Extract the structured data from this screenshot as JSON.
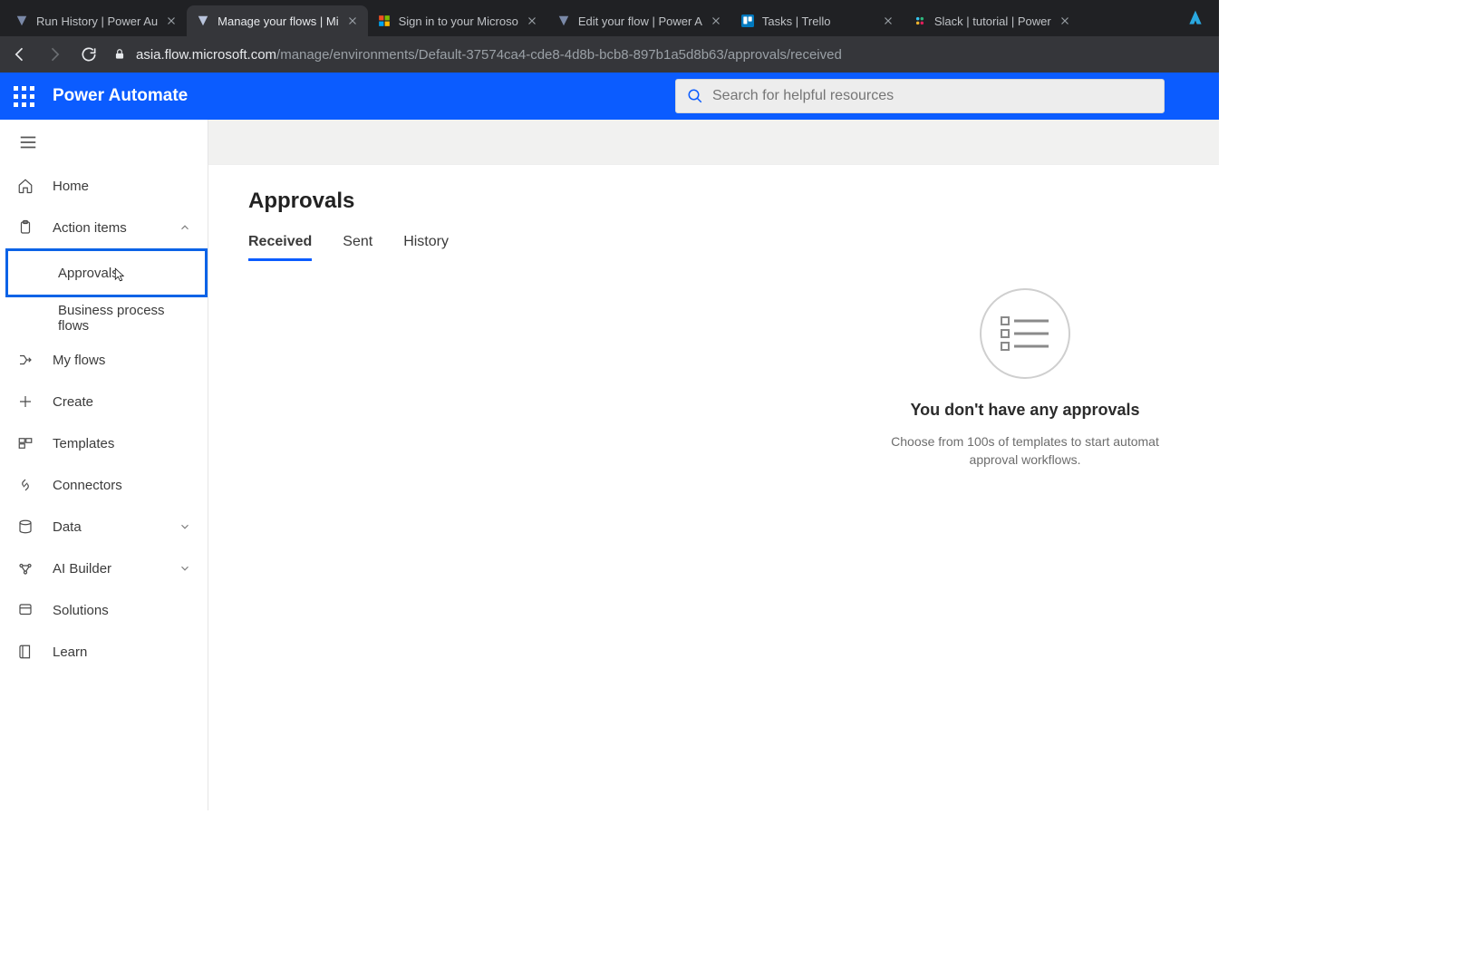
{
  "browser": {
    "tabs": [
      {
        "title": "Run History | Power Au"
      },
      {
        "title": "Manage your flows | Mi"
      },
      {
        "title": "Sign in to your Microso"
      },
      {
        "title": "Edit your flow | Power A"
      },
      {
        "title": "Tasks | Trello"
      },
      {
        "title": "Slack | tutorial | Power"
      }
    ],
    "url_host": "asia.flow.microsoft.com",
    "url_path": "/manage/environments/Default-37574ca4-cde8-4d8b-bcb8-897b1a5d8b63/approvals/received"
  },
  "header": {
    "brand": "Power Automate",
    "search_placeholder": "Search for helpful resources"
  },
  "sidebar": {
    "home": "Home",
    "action_items": "Action items",
    "approvals": "Approvals",
    "bpf": "Business process flows",
    "my_flows": "My flows",
    "create": "Create",
    "templates": "Templates",
    "connectors": "Connectors",
    "data": "Data",
    "ai_builder": "AI Builder",
    "solutions": "Solutions",
    "learn": "Learn"
  },
  "page": {
    "title": "Approvals",
    "tabs": {
      "received": "Received",
      "sent": "Sent",
      "history": "History"
    },
    "empty_title": "You don't have any approvals",
    "empty_sub": "Choose from 100s of templates to start automat approval workflows."
  }
}
